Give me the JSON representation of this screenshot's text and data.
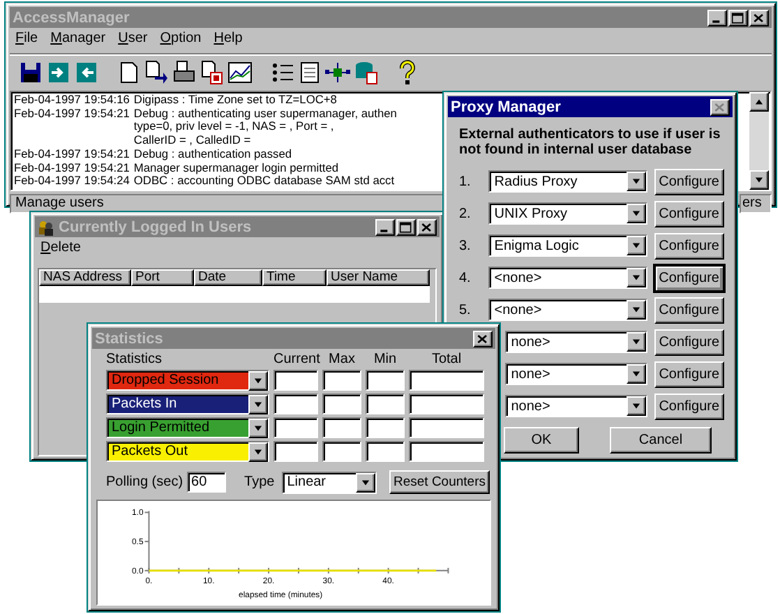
{
  "main_window": {
    "title": "AccessManager",
    "active": false,
    "menu": [
      "File",
      "Manager",
      "User",
      "Option",
      "Help"
    ],
    "log": [
      {
        "timestamp": "Feb-04-1997 19:54:16",
        "lines": [
          "Digipass : Time Zone set to TZ=LOC+8"
        ]
      },
      {
        "timestamp": "Feb-04-1997 19:54:21",
        "lines": [
          "Debug : authenticating user supermanager, authen",
          "type=0, priv level = -1, NAS = , Port = ,",
          "CallerID = , CalledID ="
        ]
      },
      {
        "timestamp": "Feb-04-1997 19:54:21",
        "lines": [
          "Debug : authentication passed"
        ]
      },
      {
        "timestamp": "Feb-04-1997 19:54:21",
        "lines": [
          "Manager supermanager login permitted"
        ]
      },
      {
        "timestamp": "Feb-04-1997 19:54:24",
        "lines": [
          "ODBC : accounting ODBC database SAM std acct"
        ]
      }
    ],
    "status_bar": [
      "Manage users",
      "ers"
    ]
  },
  "logged_in_window": {
    "title": "Currently Logged In Users",
    "active": false,
    "menu": [
      "Delete"
    ],
    "table": {
      "columns": [
        "NAS Address",
        "Port",
        "Date",
        "Time",
        "User Name"
      ]
    }
  },
  "proxy_window": {
    "title": "Proxy Manager",
    "active": true,
    "prompt": "External authenticators to use if user is not found in internal user database",
    "rows": [
      {
        "number": "1.",
        "value": "Radius Proxy",
        "button": "Configure",
        "focused": false
      },
      {
        "number": "2.",
        "value": "UNIX Proxy",
        "button": "Configure",
        "focused": false
      },
      {
        "number": "3.",
        "value": "Enigma Logic",
        "button": "Configure",
        "focused": false
      },
      {
        "number": "4.",
        "value": "<none>",
        "button": "Configure",
        "focused": true
      },
      {
        "number": "5.",
        "value": "<none>",
        "button": "Configure",
        "focused": false
      },
      {
        "value": "none>",
        "button": "Configure",
        "focused": false
      },
      {
        "value": "none>",
        "button": "Configure",
        "focused": false
      },
      {
        "value": "none>",
        "button": "Configure",
        "focused": false
      }
    ],
    "buttons": [
      "OK",
      "Cancel"
    ]
  },
  "statistics_window": {
    "title": "Statistics",
    "active": false,
    "columns": [
      "Statistics",
      "Current",
      "Max",
      "Min",
      "Total"
    ],
    "rows": [
      {
        "statistic": "Dropped Session",
        "color": "#e02810"
      },
      {
        "statistic": "Packets In",
        "color": "#182078"
      },
      {
        "statistic": "Login Permitted",
        "color": "#38a030"
      },
      {
        "statistic": "Packets Out",
        "color": "#f8f000"
      }
    ],
    "polling": {
      "label": "Polling (sec)",
      "value": "60"
    },
    "type": {
      "label": "Type",
      "value": "Linear"
    },
    "reset_button": "Reset Counters",
    "chart_data": {
      "type": "line",
      "xlabel": "elapsed time (minutes)",
      "x": [
        0,
        48
      ],
      "xlim": [
        0,
        50
      ],
      "ylim": [
        0,
        1
      ],
      "xticks": [
        {
          "value": 0,
          "label": "0."
        },
        {
          "value": 10,
          "label": "10."
        },
        {
          "value": 20,
          "label": "20."
        },
        {
          "value": 30,
          "label": "30."
        },
        {
          "value": 40,
          "label": "40."
        }
      ],
      "yticks": [
        {
          "value": 0,
          "label": "0.0"
        },
        {
          "value": 0.5,
          "label": "0.5"
        },
        {
          "value": 1,
          "label": "1.0"
        }
      ],
      "series": [
        {
          "color": "#e8e000",
          "values": [
            0,
            0
          ]
        }
      ]
    }
  }
}
